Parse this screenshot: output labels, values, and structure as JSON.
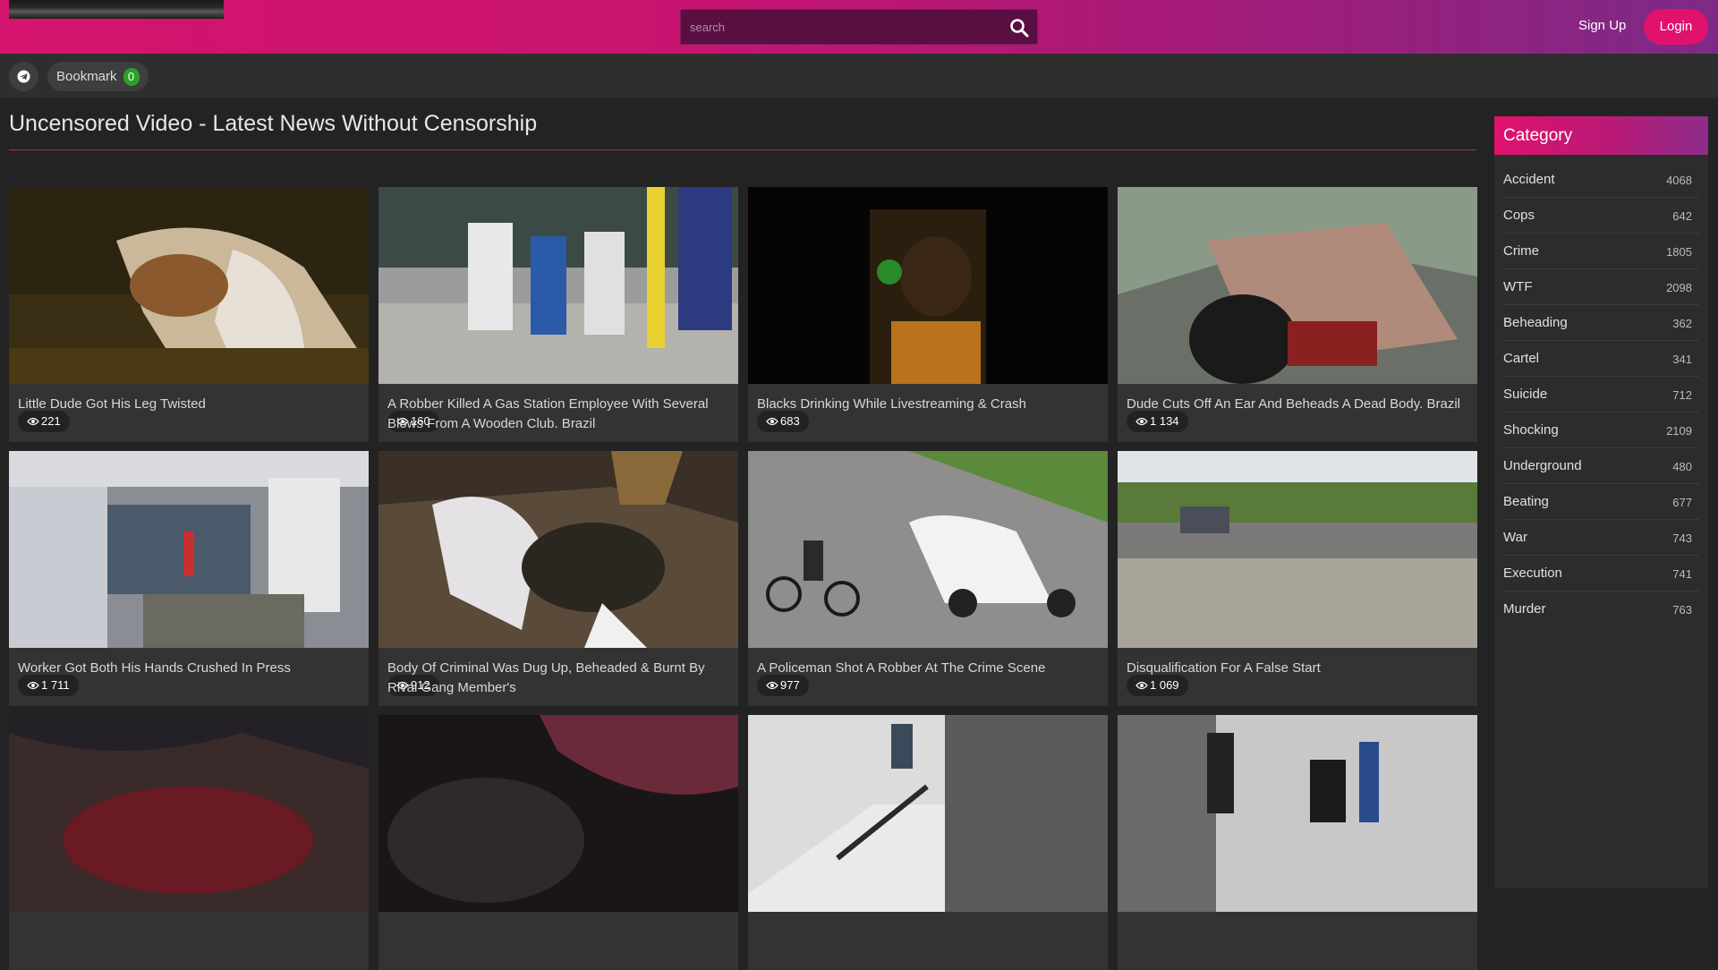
{
  "header": {
    "search_placeholder": "search",
    "signup_label": "Sign Up",
    "login_label": "Login",
    "accent_color": "#d4146e"
  },
  "subbar": {
    "telegram_icon": "telegram-icon",
    "bookmark_label": "Bookmark",
    "bookmark_count": "0"
  },
  "main": {
    "title": "Uncensored Video - Latest News Without Censorship",
    "videos": [
      {
        "views": "221",
        "title": "Little Dude Got His Leg Twisted"
      },
      {
        "views": "160",
        "title": "A Robber Killed A Gas Station Employee With Several Blows From A Wooden Club. Brazil"
      },
      {
        "views": "683",
        "title": "Blacks Drinking While Livestreaming & Crash"
      },
      {
        "views": "1 134",
        "title": "Dude Cuts Off An Ear And Beheads A Dead Body. Brazil"
      },
      {
        "views": "1 711",
        "title": "Worker Got Both His Hands Crushed In Press"
      },
      {
        "views": "912",
        "title": "Body Of Criminal Was Dug Up, Beheaded & Burnt By Rival Gang Member's"
      },
      {
        "views": "977",
        "title": "A Policeman Shot A Robber At The Crime Scene"
      },
      {
        "views": "1 069",
        "title": "Disqualification For A False Start"
      },
      {
        "views": "",
        "title": ""
      },
      {
        "views": "",
        "title": ""
      },
      {
        "views": "",
        "title": ""
      },
      {
        "views": "",
        "title": ""
      }
    ]
  },
  "sidebar": {
    "heading": "Category",
    "categories": [
      {
        "name": "Accident",
        "count": "4068"
      },
      {
        "name": "Cops",
        "count": "642"
      },
      {
        "name": "Crime",
        "count": "1805"
      },
      {
        "name": "WTF",
        "count": "2098"
      },
      {
        "name": "Beheading",
        "count": "362"
      },
      {
        "name": "Cartel",
        "count": "341"
      },
      {
        "name": "Suicide",
        "count": "712"
      },
      {
        "name": "Shocking",
        "count": "2109"
      },
      {
        "name": "Underground",
        "count": "480"
      },
      {
        "name": "Beating",
        "count": "677"
      },
      {
        "name": "War",
        "count": "743"
      },
      {
        "name": "Execution",
        "count": "741"
      },
      {
        "name": "Murder",
        "count": "763"
      }
    ]
  }
}
